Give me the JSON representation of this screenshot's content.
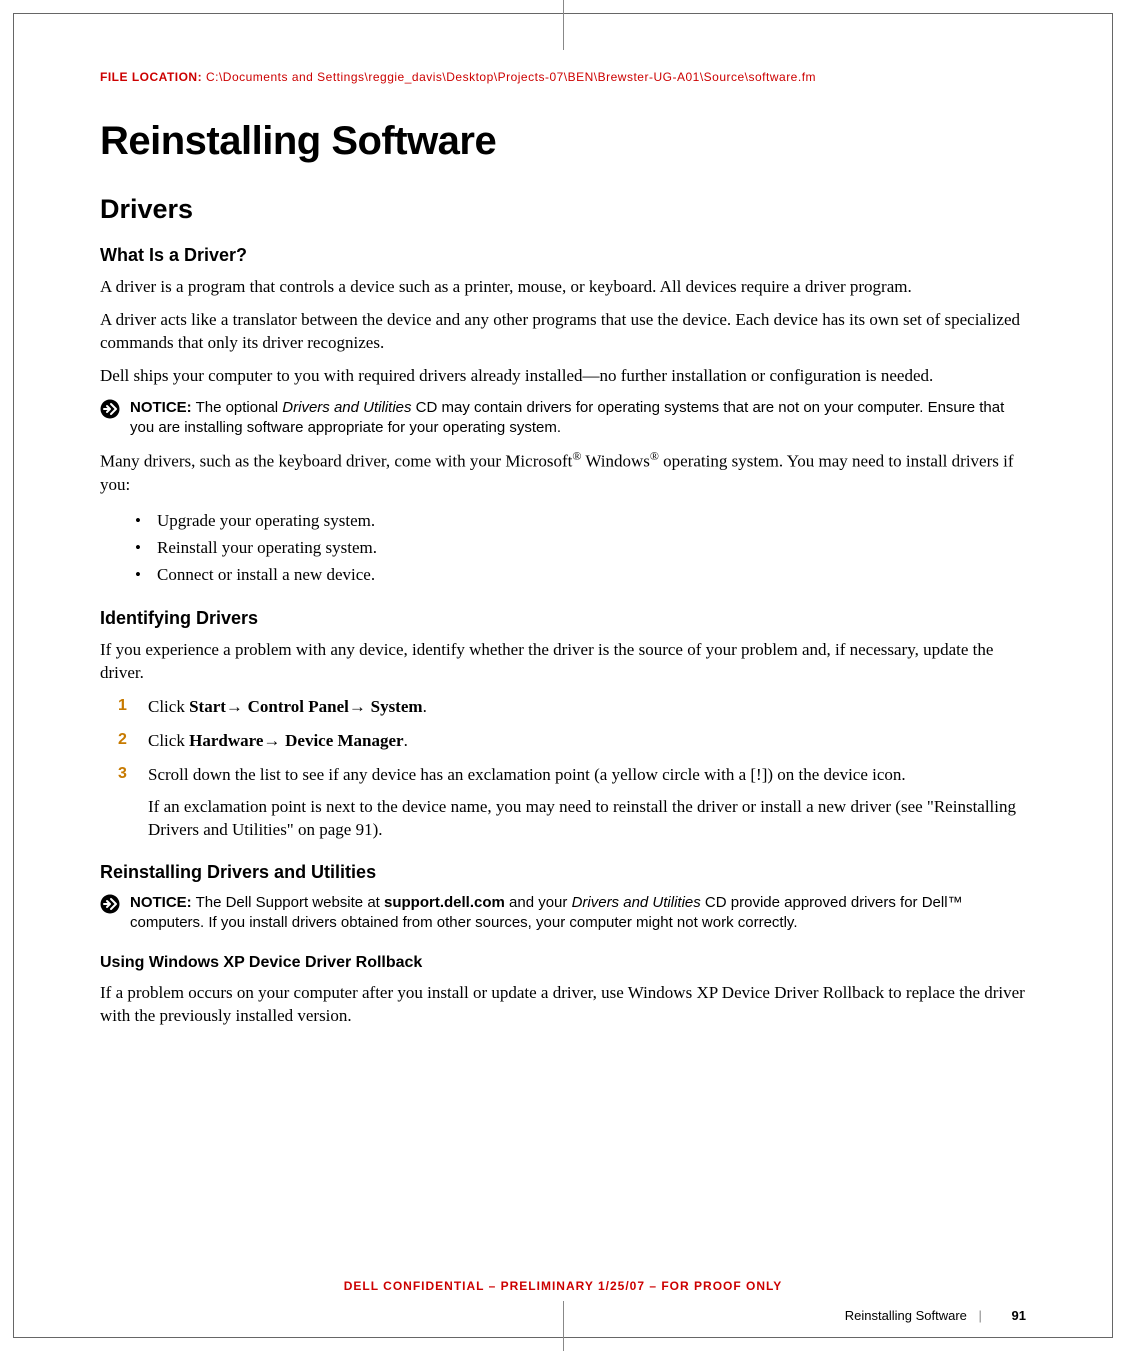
{
  "file_location": {
    "label": "FILE LOCATION:",
    "path": "C:\\Documents and Settings\\reggie_davis\\Desktop\\Projects-07\\BEN\\Brewster-UG-A01\\Source\\software.fm"
  },
  "title": "Reinstalling Software",
  "section1": {
    "heading": "Drivers",
    "sub1": {
      "heading": "What Is a Driver?",
      "p1": "A driver is a program that controls a device such as a printer, mouse, or keyboard. All devices require a driver program.",
      "p2": "A driver acts like a translator between the device and any other programs that use the device. Each device has its own set of specialized commands that only its driver recognizes.",
      "p3": "Dell ships your computer to you with required drivers already installed—no further installation or configuration is needed.",
      "notice1_label": "NOTICE:",
      "notice1_pre": " The optional ",
      "notice1_italic": "Drivers and Utilities",
      "notice1_post": " CD may contain drivers for operating systems that are not on your computer. Ensure that you are installing software appropriate for your operating system.",
      "p4_pre": "Many drivers, such as the keyboard driver, come with your Microsoft",
      "p4_reg1": "®",
      "p4_mid": " Windows",
      "p4_reg2": "®",
      "p4_post": " operating system. You may need to install drivers if you:",
      "bullets": [
        "Upgrade your operating system.",
        "Reinstall your operating system.",
        "Connect or install a new device."
      ]
    },
    "sub2": {
      "heading": "Identifying Drivers",
      "p1": "If you experience a problem with any device, identify whether the driver is the source of your problem and, if necessary, update the driver.",
      "step1_pre": "Click ",
      "step1_b1": "Start",
      "step1_arr1": "→ ",
      "step1_b2": "Control Panel",
      "step1_arr2": "→ ",
      "step1_b3": "System",
      "step1_post": ".",
      "step2_pre": "Click ",
      "step2_b1": "Hardware",
      "step2_arr1": "→ ",
      "step2_b2": "Device Manager",
      "step2_post": ".",
      "step3": "Scroll down the list to see if any device has an exclamation point (a yellow circle with a [!]) on the device icon.",
      "step3_followup": "If an exclamation point is next to the device name, you may need to reinstall the driver or install a new driver (see \"Reinstalling Drivers and Utilities\" on page 91)."
    },
    "sub3": {
      "heading": "Reinstalling Drivers and Utilities",
      "notice2_label": "NOTICE:",
      "notice2_pre": " The Dell Support website at ",
      "notice2_b1": "support.dell.com",
      "notice2_mid": " and your ",
      "notice2_italic": "Drivers and Utilities",
      "notice2_post": " CD provide approved drivers for Dell™ computers. If you install drivers obtained from other sources, your computer might not work correctly.",
      "sub3a_heading": "Using Windows XP Device Driver Rollback",
      "sub3a_p1": "If a problem occurs on your computer after you install or update a driver, use Windows XP Device Driver Rollback to replace the driver with the previously installed version."
    }
  },
  "confidential": "DELL CONFIDENTIAL – PRELIMINARY 1/25/07 – FOR PROOF ONLY",
  "footer": {
    "section": "Reinstalling Software",
    "page": "91"
  }
}
